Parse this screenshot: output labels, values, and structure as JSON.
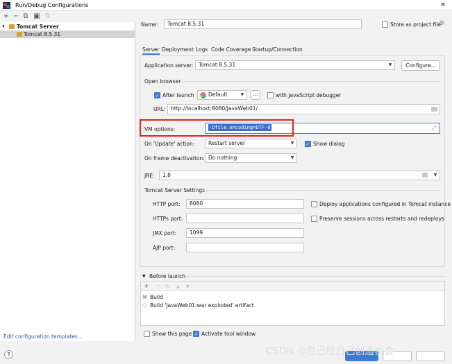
{
  "window": {
    "title": "Run/Debug Configurations",
    "close": "✕"
  },
  "toolbar": {
    "add": "+",
    "remove": "−",
    "copy": "⧉",
    "folder": "▣",
    "sort": "⇅"
  },
  "tree": {
    "root": {
      "arrow": "▾",
      "label": "Tomcat Server"
    },
    "child": {
      "label": "Tomcat 8.5.31"
    },
    "edit_templates": "Edit configuration templates..."
  },
  "name_row": {
    "label": "Name:",
    "value": "Tomcat 8.5.31",
    "store_label": "Store as project file",
    "gear": "⚙"
  },
  "tabs": [
    "Server",
    "Deployment",
    "Logs",
    "Code Coverage",
    "Startup/Connection"
  ],
  "server": {
    "app_server_label": "Application server:",
    "app_server_value": "Tomcat 8.5.31",
    "configure_label": "Configure...",
    "open_browser": "Open browser",
    "after_launch_label": "After launch",
    "browser_value": "Default",
    "ellipsis": "...",
    "js_debugger_label": "with JavaScript debugger",
    "url_label": "URL:",
    "url_value": "http://localhost:8080/JavaWeb01/",
    "vm_label": "VM options:",
    "vm_value": "-Dfile.encoding=UTF-8",
    "update_label": "On 'Update' action:",
    "update_value": "Restart server",
    "show_dialog_label": "Show dialog",
    "frame_label": "On frame deactivation:",
    "frame_value": "Do nothing",
    "jre_label": "JRE:",
    "jre_value": "1.8",
    "tomcat_settings": "Tomcat Server Settings",
    "http_label": "HTTP port:",
    "http_value": "8080",
    "https_label": "HTTPs port:",
    "https_value": "",
    "jmx_label": "JMX port:",
    "jmx_value": "1099",
    "ajp_label": "AJP port:",
    "ajp_value": "",
    "deploy_label": "Deploy applications configured in Tomcat instance",
    "preserve_label": "Preserve sessions across restarts and redeploys"
  },
  "before_launch": {
    "title": "Before launch",
    "items": [
      "Build",
      "Build 'JavaWeb01:war exploded' artifact"
    ]
  },
  "footer": {
    "show_page_label": "Show this page",
    "activate_label": "Activate tool window",
    "help": "?",
    "watermark": "CSDN @自己给自己创造机会"
  }
}
